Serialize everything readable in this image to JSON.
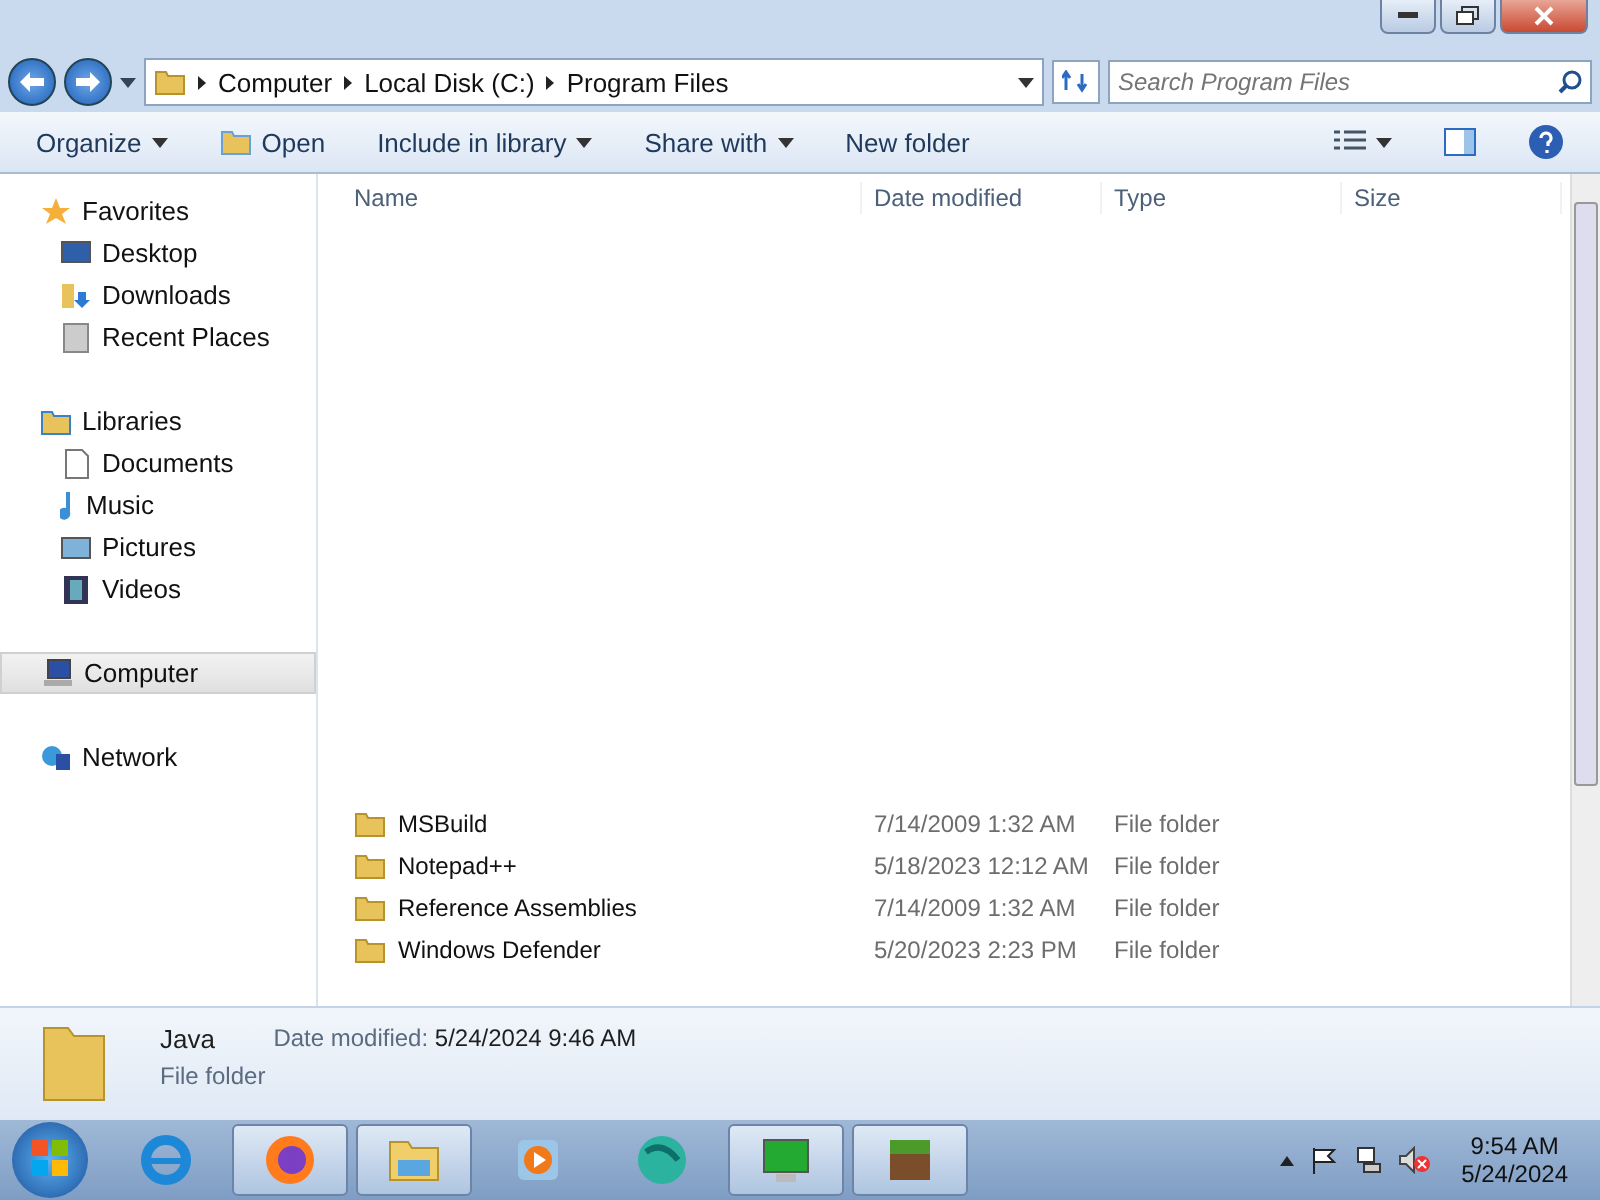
{
  "breadcrumb": [
    "Computer",
    "Local Disk (C:)",
    "Program Files"
  ],
  "search": {
    "placeholder": "Search Program Files"
  },
  "toolbar": [
    {
      "label": "Organize",
      "kind": "menu"
    },
    {
      "label": "Open",
      "kind": "icon"
    },
    {
      "label": "Include in library",
      "kind": "menu"
    },
    {
      "label": "Share with",
      "kind": "menu"
    },
    {
      "label": "New folder",
      "kind": "plain"
    }
  ],
  "sidebar": [
    {
      "label": "Favorites",
      "selected": false,
      "children": [
        {
          "label": "Desktop",
          "selected": false
        },
        {
          "label": "Downloads",
          "selected": false
        },
        {
          "label": "Recent Places",
          "selected": false
        }
      ]
    },
    {
      "label": "Libraries",
      "selected": false,
      "children": [
        {
          "label": "Documents",
          "selected": false
        },
        {
          "label": "Music",
          "selected": false
        },
        {
          "label": "Pictures",
          "selected": false
        },
        {
          "label": "Videos",
          "selected": false
        }
      ]
    },
    {
      "label": "Computer",
      "selected": true
    },
    {
      "label": "Network",
      "selected": false
    }
  ],
  "columns": [
    "Name",
    "Date modified",
    "Type",
    "Size"
  ],
  "rows": [
    {
      "name": "MSBuild",
      "date": "7/14/2009 1:32 AM",
      "type": "File folder"
    },
    {
      "name": "Notepad++",
      "date": "5/18/2023 12:12 AM",
      "type": "File folder"
    },
    {
      "name": "Reference Assemblies",
      "date": "7/14/2009 1:32 AM",
      "type": "File folder"
    },
    {
      "name": "Windows Defender",
      "date": "5/20/2023 2:23 PM",
      "type": "File folder"
    }
  ],
  "details": {
    "name": "Java",
    "date_label": "Date modified:",
    "date": "5/24/2024 9:46 AM",
    "type": "File folder"
  },
  "taskbar": [
    {
      "running": false
    },
    {
      "running": true
    },
    {
      "running": true
    },
    {
      "running": false
    },
    {
      "running": false
    },
    {
      "running": true
    },
    {
      "running": true
    }
  ],
  "clock": {
    "time": "9:54 AM",
    "date": "5/24/2024"
  }
}
